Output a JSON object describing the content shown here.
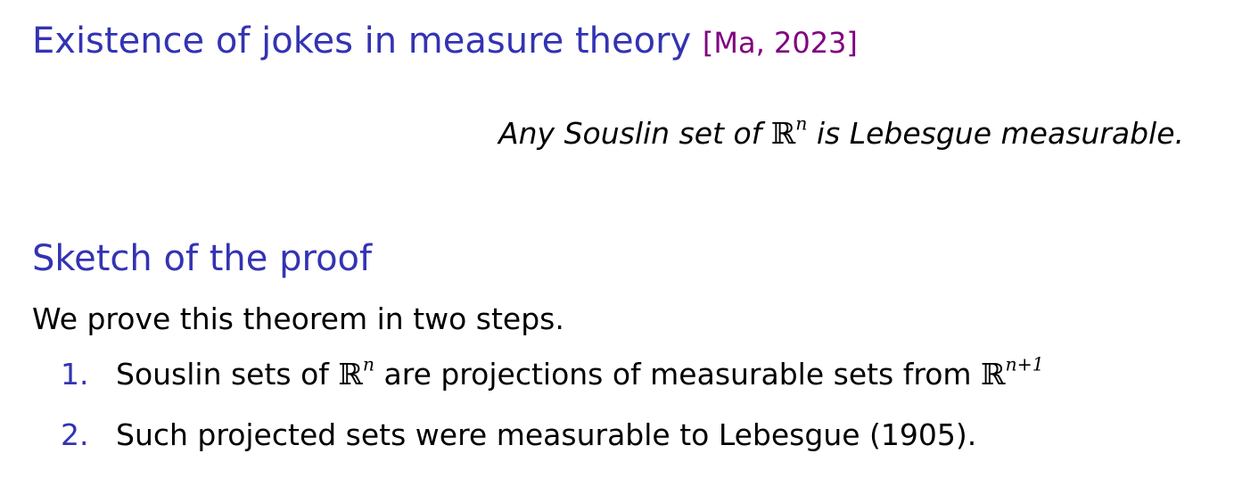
{
  "frame": {
    "title": "Existence of jokes in measure theory",
    "citation": "[Ma, 2023]"
  },
  "theorem": {
    "text_before": "Any Souslin set of ",
    "math_base": "ℝ",
    "math_exp": "n",
    "text_after": " is Lebesgue measurable."
  },
  "proof": {
    "title": "Sketch of the proof",
    "intro": "We prove this theorem in two steps.",
    "steps": [
      {
        "number": "1.",
        "text_a": "Souslin sets of ",
        "math1_base": "ℝ",
        "math1_exp": "n",
        "text_b": " are projections of measurable sets from ",
        "math2_base": "ℝ",
        "math2_exp": "n+1"
      },
      {
        "number": "2.",
        "text": "Such projected sets were measurable to Lebesgue (1905)."
      }
    ]
  },
  "colors": {
    "structure": "#3333b3",
    "citation": "#800080",
    "text": "#000000"
  }
}
